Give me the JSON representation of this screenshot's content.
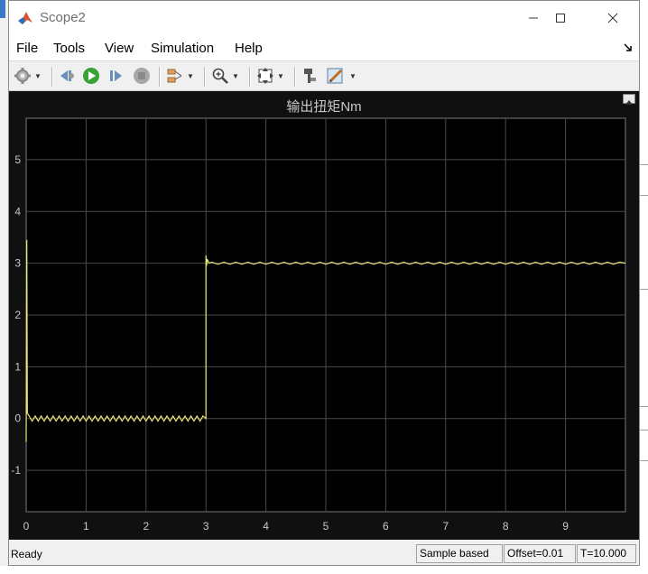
{
  "window": {
    "title": "Scope2"
  },
  "menu": [
    "File",
    "Tools",
    "View",
    "Simulation",
    "Help"
  ],
  "toolbar": {
    "buttons": [
      "settings-icon",
      "step-back-icon",
      "run-icon",
      "step-forward-icon",
      "stop-icon",
      "signal-selector-icon",
      "zoom-icon",
      "fit-to-view-icon",
      "highlight-block-icon",
      "edit-icon"
    ]
  },
  "plot": {
    "title": "输出扭矩Nm",
    "background": "#000000",
    "trace_color": "#e8e878",
    "grid_color": "#4a4a4a"
  },
  "chart_data": {
    "type": "line",
    "title": "输出扭矩Nm",
    "xlabel": "",
    "ylabel": "",
    "xlim": [
      0,
      10
    ],
    "ylim": [
      -1.8,
      5.8
    ],
    "xticks": [
      0,
      1,
      2,
      3,
      4,
      5,
      6,
      7,
      8,
      9
    ],
    "yticks": [
      -1,
      0,
      1,
      2,
      3,
      4,
      5
    ],
    "grid": true,
    "series": [
      {
        "name": "",
        "color": "#e8e878",
        "x": [
          0,
          0.01,
          0.02,
          0.05,
          0.1,
          0.15,
          0.2,
          0.25,
          0.3,
          0.35,
          0.4,
          0.45,
          0.5,
          0.55,
          0.6,
          0.65,
          0.7,
          0.75,
          0.8,
          0.85,
          0.9,
          0.95,
          1.0,
          1.05,
          1.1,
          1.15,
          1.2,
          1.25,
          1.3,
          1.35,
          1.4,
          1.45,
          1.5,
          1.55,
          1.6,
          1.65,
          1.7,
          1.75,
          1.8,
          1.85,
          1.9,
          1.95,
          2.0,
          2.05,
          2.1,
          2.15,
          2.2,
          2.25,
          2.3,
          2.35,
          2.4,
          2.45,
          2.5,
          2.55,
          2.6,
          2.65,
          2.7,
          2.75,
          2.8,
          2.85,
          2.9,
          2.95,
          3.0,
          3.0,
          3.01,
          3.02,
          3.05,
          3.1,
          3.2,
          3.3,
          3.4,
          3.5,
          3.6,
          3.7,
          3.8,
          3.9,
          4.0,
          4.1,
          4.2,
          4.3,
          4.4,
          4.5,
          4.6,
          4.7,
          4.8,
          4.9,
          5.0,
          5.1,
          5.2,
          5.3,
          5.4,
          5.5,
          5.6,
          5.7,
          5.8,
          5.9,
          6.0,
          6.1,
          6.2,
          6.3,
          6.4,
          6.5,
          6.6,
          6.7,
          6.8,
          6.9,
          7.0,
          7.1,
          7.2,
          7.3,
          7.4,
          7.5,
          7.6,
          7.7,
          7.8,
          7.9,
          8.0,
          8.1,
          8.2,
          8.3,
          8.4,
          8.5,
          8.6,
          8.7,
          8.8,
          8.9,
          9.0,
          9.1,
          9.2,
          9.3,
          9.4,
          9.5,
          9.6,
          9.7,
          9.8,
          9.9,
          10.0
        ],
        "y": [
          -0.45,
          3.45,
          0.1,
          0.05,
          -0.05,
          0.05,
          -0.05,
          0.05,
          -0.05,
          0.05,
          -0.05,
          0.05,
          -0.05,
          0.05,
          -0.05,
          0.05,
          -0.05,
          0.05,
          -0.05,
          0.05,
          -0.05,
          0.05,
          -0.05,
          0.05,
          -0.05,
          0.05,
          -0.05,
          0.05,
          -0.05,
          0.05,
          -0.05,
          0.05,
          -0.05,
          0.05,
          -0.05,
          0.05,
          -0.05,
          0.05,
          -0.05,
          0.05,
          -0.05,
          0.05,
          -0.05,
          0.05,
          -0.05,
          0.05,
          -0.05,
          0.05,
          -0.05,
          0.05,
          -0.05,
          0.05,
          -0.05,
          0.05,
          -0.05,
          0.05,
          -0.05,
          0.05,
          -0.05,
          0.05,
          -0.05,
          0.05,
          0.0,
          3.15,
          2.95,
          3.08,
          3.0,
          3.02,
          2.98,
          3.02,
          2.98,
          3.02,
          2.98,
          3.02,
          2.98,
          3.02,
          2.98,
          3.02,
          2.98,
          3.02,
          2.98,
          3.02,
          2.98,
          3.02,
          2.98,
          3.02,
          2.98,
          3.02,
          2.98,
          3.02,
          2.98,
          3.02,
          2.98,
          3.02,
          2.98,
          3.02,
          2.98,
          3.02,
          2.98,
          3.02,
          2.98,
          3.02,
          2.98,
          3.02,
          2.98,
          3.02,
          2.98,
          3.02,
          2.98,
          3.02,
          2.98,
          3.02,
          2.98,
          3.02,
          2.98,
          3.02,
          2.98,
          3.02,
          2.98,
          3.02,
          2.98,
          3.02,
          2.98,
          3.02,
          2.98,
          3.02,
          2.98,
          3.02,
          2.98,
          3.02,
          2.98,
          3.02,
          2.98,
          3.02,
          2.98,
          3.02,
          3.0
        ]
      }
    ]
  },
  "status": {
    "ready": "Ready",
    "mode": "Sample based",
    "offset": "Offset=0.01",
    "time": "T=10.000"
  }
}
